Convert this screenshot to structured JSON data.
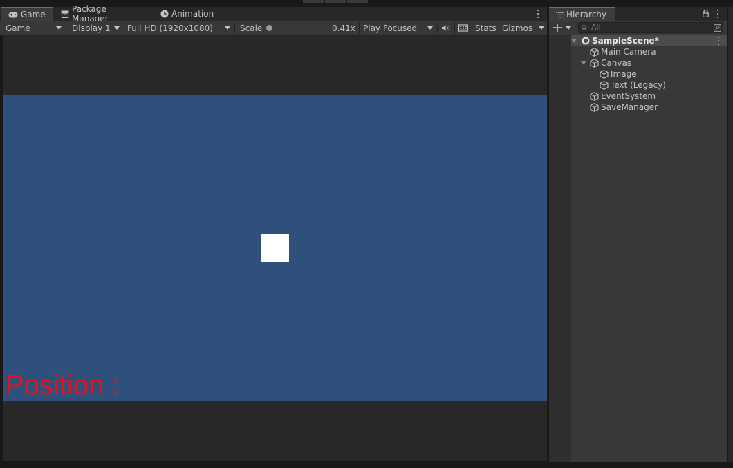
{
  "tabs": [
    {
      "label": "Game",
      "icon": "gamepad-icon",
      "active": true
    },
    {
      "label": "Package Manager",
      "icon": "package-icon",
      "active": false
    },
    {
      "label": "Animation",
      "icon": "clock-icon",
      "active": false
    }
  ],
  "game_toolbar": {
    "view_mode": "Game",
    "display": "Display 1",
    "resolution": "Full HD (1920x1080)",
    "scale_label": "Scale",
    "scale_value": "0.41x",
    "scale_fraction": 0.0,
    "play_mode": "Play Focused",
    "stats": "Stats",
    "gizmos": "Gizmos"
  },
  "game_view": {
    "position_text": "Position :",
    "background_color": "#30507c",
    "text_color": "#e8101c"
  },
  "hierarchy": {
    "tab_label": "Hierarchy",
    "search_placeholder": "All",
    "scene": "SampleScene*",
    "items": [
      {
        "label": "Main Camera"
      },
      {
        "label": "Canvas"
      },
      {
        "label": "Image"
      },
      {
        "label": "Text (Legacy)"
      },
      {
        "label": "EventSystem"
      },
      {
        "label": "SaveManager"
      }
    ]
  },
  "colors": {
    "accent": "#3a79bb",
    "panel": "#383838"
  }
}
